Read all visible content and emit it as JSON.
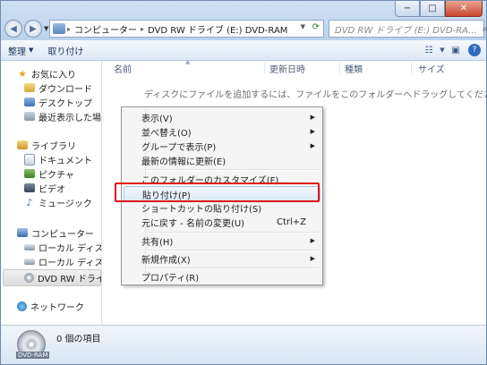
{
  "window": {
    "caption_min": "−",
    "caption_max": "□",
    "caption_close": "✕"
  },
  "address": {
    "segments": [
      "コンピューター",
      "DVD RW ドライブ (E:) DVD-RAM"
    ],
    "sep": "▸"
  },
  "search": {
    "placeholder": "DVD RW ドライブ (E:) DVD-RA..."
  },
  "toolbar": {
    "organize_label": "整理",
    "paste_label": "取り付け"
  },
  "navpane": {
    "favorites": "お気に入り",
    "downloads": "ダウンロード",
    "desktop": "デスクトップ",
    "recent": "最近表示した場所",
    "libraries": "ライブラリ",
    "documents": "ドキュメント",
    "pictures": "ピクチャ",
    "videos": "ビデオ",
    "music": "ミュージック",
    "computer": "コンピューター",
    "local1": "ローカル ディスク",
    "local2": "ローカル ディスク",
    "dvd": "DVD RW ドライブ",
    "network": "ネットワーク"
  },
  "columns": {
    "name": "名前",
    "modified": "更新日時",
    "type": "種類",
    "size": "サイズ"
  },
  "content": {
    "empty_message": "ディスクにファイルを追加するには、ファイルをこのフォルダーへドラッグしてください。"
  },
  "context_menu": {
    "view": "表示(V)",
    "sort": "並べ替え(O)",
    "group": "グループで表示(P)",
    "refresh": "最新の情報に更新(E)",
    "customize": "このフォルダーのカスタマイズ(F)...",
    "paste": "貼り付け(P)",
    "paste_shortcut": "ショートカットの貼り付け(S)",
    "undo": "元に戻す - 名前の変更(U)",
    "undo_accel": "Ctrl+Z",
    "share": "共有(H)",
    "new": "新規作成(X)",
    "properties": "プロパティ(R)"
  },
  "details": {
    "item_count": "0 個の項目",
    "drive_label": "DVD-RAM"
  }
}
